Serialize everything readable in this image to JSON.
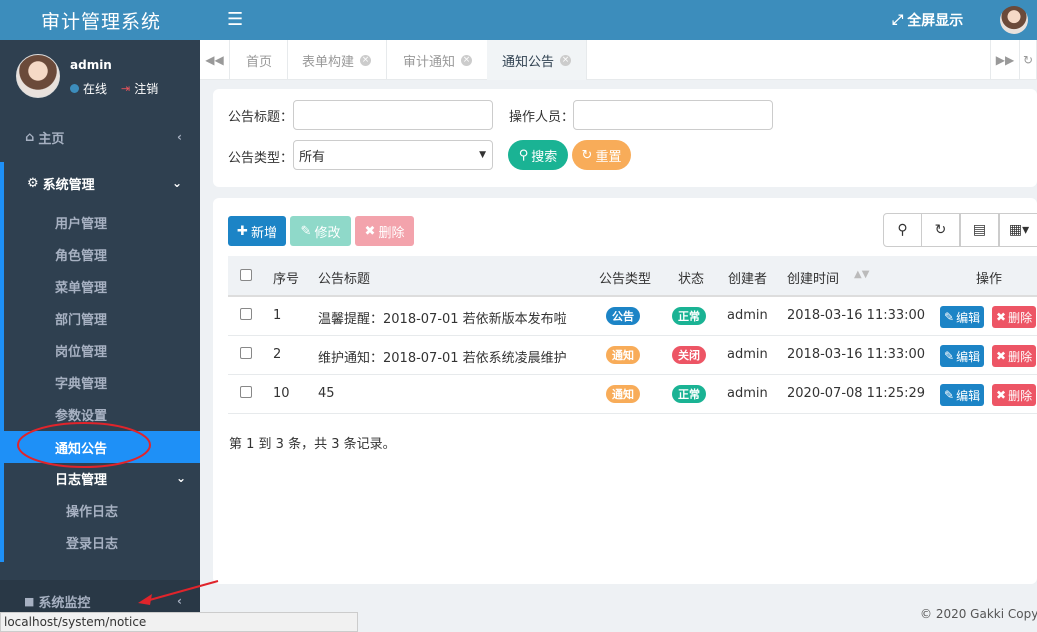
{
  "app": {
    "title": "审计管理系统"
  },
  "user": {
    "name": "admin",
    "status": "在线",
    "logout": "注销"
  },
  "sidebar": {
    "home": "主页",
    "system": "系统管理",
    "items": [
      "用户管理",
      "角色管理",
      "菜单管理",
      "部门管理",
      "岗位管理",
      "字典管理",
      "参数设置",
      "通知公告"
    ],
    "log": "日志管理",
    "log_items": [
      "操作日志",
      "登录日志"
    ],
    "monitor": "系统监控"
  },
  "header": {
    "fullscreen": "全屏显示"
  },
  "tabs": [
    "首页",
    "表单构建",
    "审计通知",
    "通知公告"
  ],
  "search": {
    "title_label": "公告标题：",
    "operator_label": "操作人员：",
    "type_label": "公告类型：",
    "type_value": "所有",
    "search_btn": "搜索",
    "reset_btn": "重置"
  },
  "toolbar": {
    "add": "新增",
    "edit": "修改",
    "delete": "删除"
  },
  "table": {
    "columns": [
      "序号",
      "公告标题",
      "公告类型",
      "状态",
      "创建者",
      "创建时间",
      "操作"
    ],
    "rows": [
      {
        "id": "1",
        "title": "温馨提醒：2018-07-01 若依新版本发布啦",
        "type": "公告",
        "status": "正常",
        "creator": "admin",
        "time": "2018-03-16 11:33:00"
      },
      {
        "id": "2",
        "title": "维护通知：2018-07-01 若依系统凌晨维护",
        "type": "通知",
        "status": "关闭",
        "creator": "admin",
        "time": "2018-03-16 11:33:00"
      },
      {
        "id": "10",
        "title": "45",
        "type": "通知",
        "status": "正常",
        "creator": "admin",
        "time": "2020-07-08 11:25:29"
      }
    ],
    "edit_label": "编辑",
    "delete_label": "删除",
    "summary": "第 1 到 3 条，共 3 条记录。"
  },
  "footer": "© 2020 Gakki Copy",
  "status_url": "localhost/system/notice",
  "colors": {
    "primary": "#1c84c6",
    "success": "#1ab394",
    "warning": "#f8ac59",
    "danger": "#ed5565",
    "sidebar": "#2f4050",
    "header": "#3c8dbc"
  }
}
